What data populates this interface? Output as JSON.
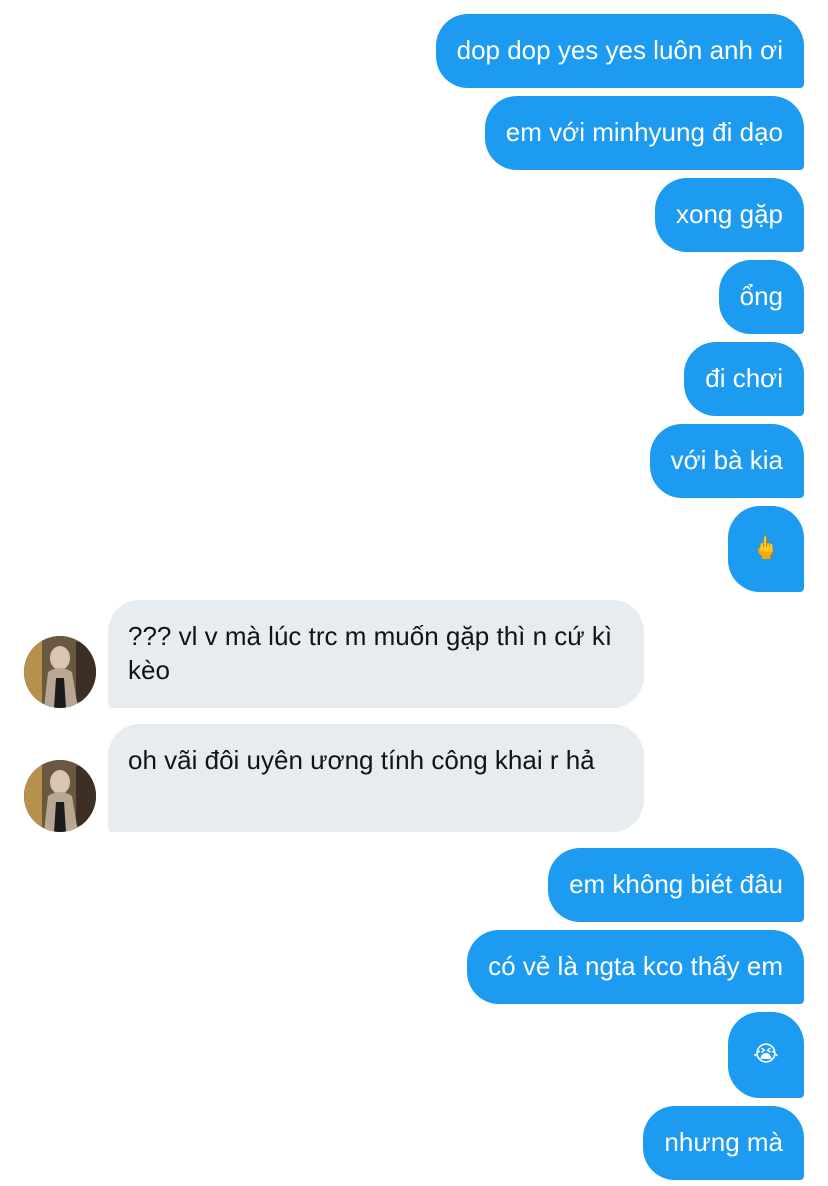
{
  "messages": [
    {
      "text": "dop dop yes yes luôn anh ơi"
    },
    {
      "text": "em với minhyung đi dạo"
    },
    {
      "text": "xong gặp"
    },
    {
      "text": "ổng"
    },
    {
      "text": "đi chơi"
    },
    {
      "text": "với bà kia"
    },
    {
      "text": "🖕"
    },
    {
      "text": "??? vl v mà lúc trc m muốn gặp thì n cứ kì kèo"
    },
    {
      "text": "oh vãi đôi uyên ương tính công khai r hả"
    },
    {
      "text": "em không biét đâu"
    },
    {
      "text": "có vẻ là ngta kco thấy em"
    },
    {
      "text": "😭"
    },
    {
      "text": "nhưng mà"
    }
  ],
  "colors": {
    "outgoing_bubble": "#1d9bf0",
    "incoming_bubble": "#e7ecf0"
  }
}
